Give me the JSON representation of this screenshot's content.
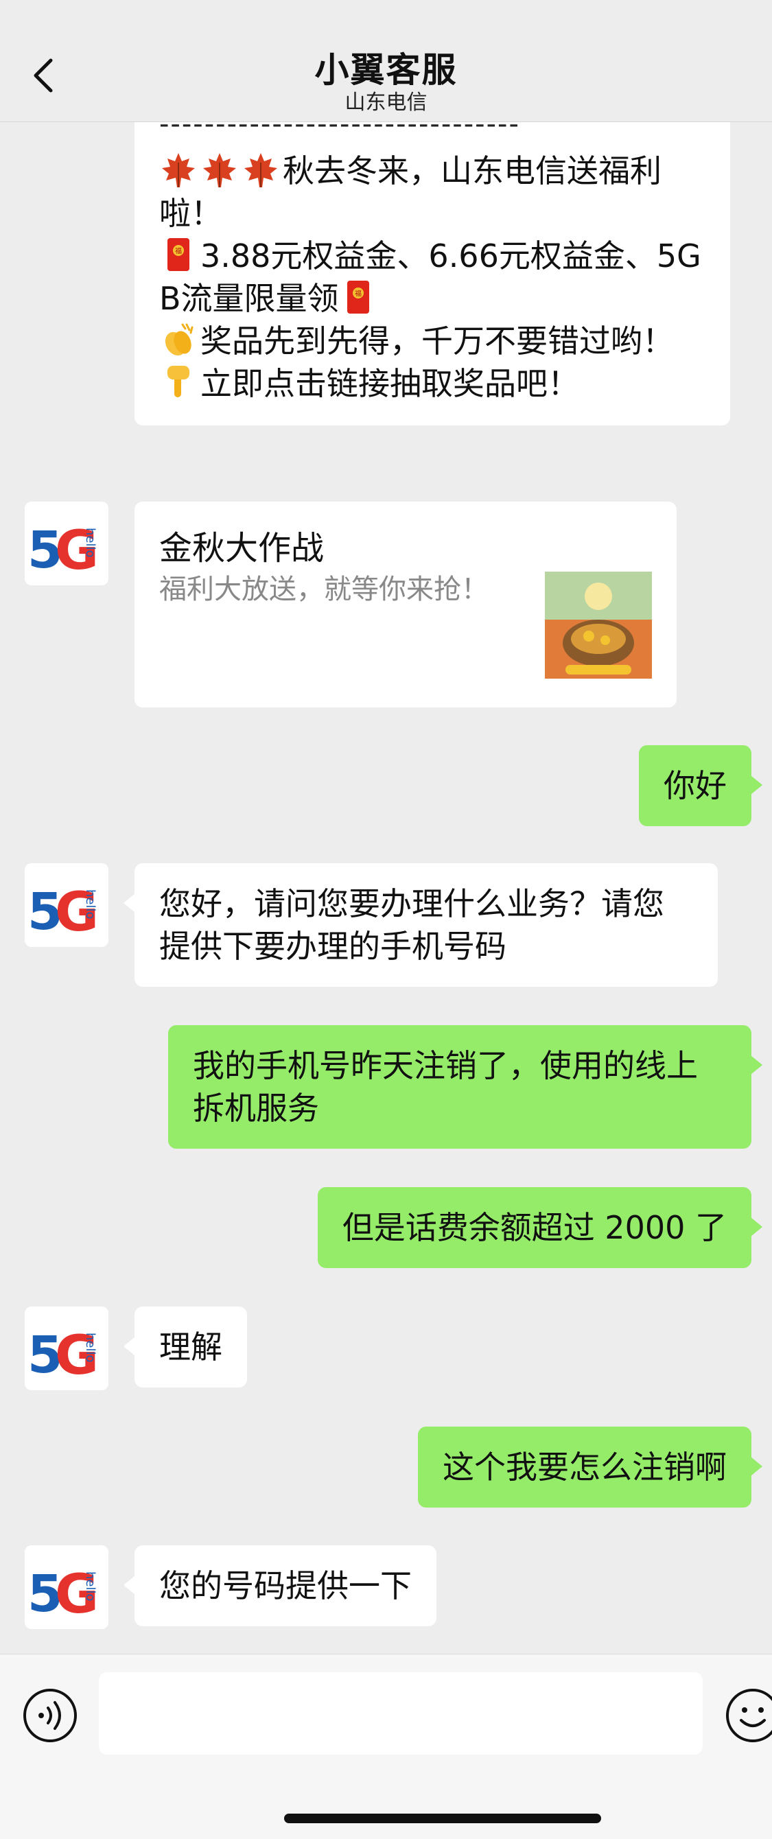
{
  "header": {
    "title": "小翼客服",
    "subtitle": "山东电信"
  },
  "promo": {
    "dashes": "--------------------------------",
    "line1": "秋去冬来，山东电信送福利啦！",
    "line2": "3.88元权益金、6.66元权益金、5GB流量限量领",
    "line3": "奖品先到先得，千万不要错过哟！",
    "line4": "立即点击链接抽取奖品吧！"
  },
  "card": {
    "title": "金秋大作战",
    "description": "福利大放送，就等你来抢！"
  },
  "avatar": {
    "badge": "5G",
    "tag": "hello"
  },
  "messages": [
    {
      "side": "right",
      "text": "你好"
    },
    {
      "side": "left",
      "text": "您好，请问您要办理什么业务？请您提供下要办理的手机号码"
    },
    {
      "side": "right",
      "text": "我的手机号昨天注销了，使用的线上拆机服务"
    },
    {
      "side": "right",
      "text": "但是话费余额超过 2000 了"
    },
    {
      "side": "left",
      "text": "理解"
    },
    {
      "side": "right",
      "text": "这个我要怎么注销啊"
    },
    {
      "side": "left",
      "text": "您的号码提供一下"
    }
  ],
  "colors": {
    "background": "#ededed",
    "right_bubble": "#95ec69",
    "left_bubble": "#ffffff"
  },
  "icons": {
    "back": "chevron-left-icon",
    "voice": "voice-icon",
    "emoji": "emoji-icon"
  }
}
